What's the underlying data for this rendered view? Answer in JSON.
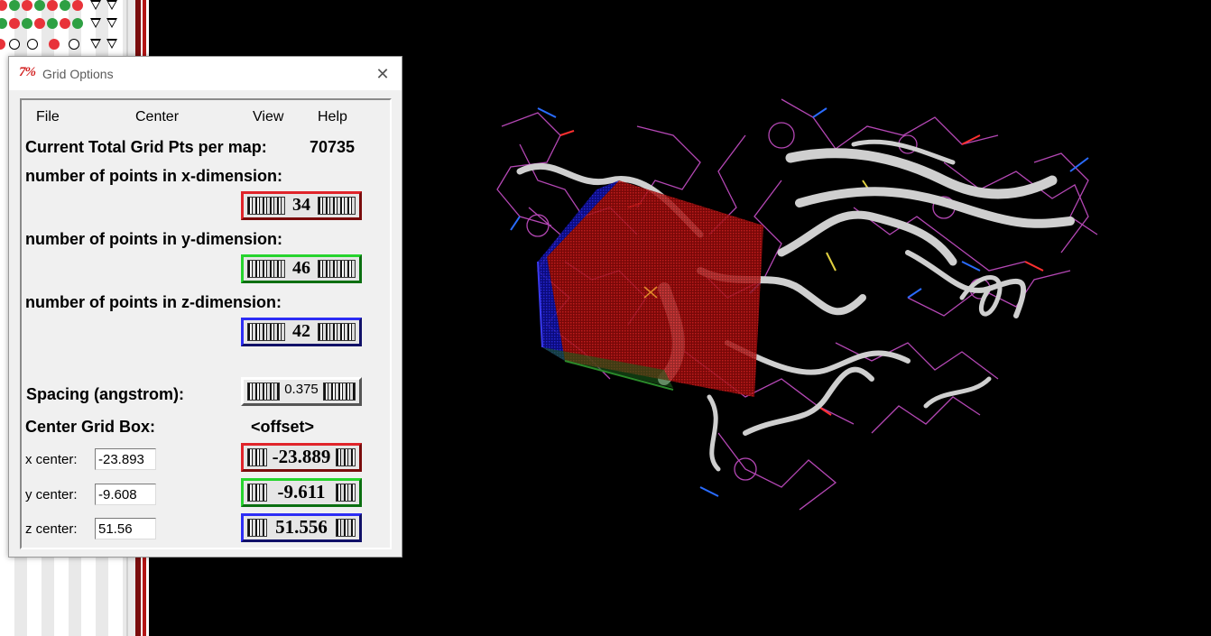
{
  "dialog": {
    "title": "Grid Options",
    "tk_icon": "7%",
    "close_glyph": "✕"
  },
  "menu": {
    "file": "File",
    "center": "Center",
    "view": "View",
    "help": "Help"
  },
  "grid": {
    "total_label": "Current Total Grid Pts per map:",
    "total_value": "70735",
    "x_label": "number of points in x-dimension:",
    "x_value": "34",
    "y_label": "number of points in y-dimension:",
    "y_value": "46",
    "z_label": "number of points in z-dimension:",
    "z_value": "42",
    "spacing_label": "Spacing (angstrom):",
    "spacing_value": "0.375"
  },
  "center": {
    "heading": "Center Grid Box:",
    "offset_label": "<offset>",
    "x_label": "x center:",
    "x_entry": "-23.893",
    "x_offset": "-23.889",
    "y_label": "y center:",
    "y_entry": "-9.608",
    "y_offset": "-9.611",
    "z_label": "z center:",
    "z_entry": "51.56",
    "z_offset": "51.556"
  },
  "colors": {
    "x_axis": "#e0242a",
    "y_axis": "#27d42e",
    "z_axis": "#2d2df5",
    "viewer_bg": "#000000",
    "grid_box_red": "#d11a1a",
    "grid_box_blue": "#1a1ad1"
  },
  "icons": [
    "tk-icon",
    "close-icon",
    "thumbwheel-icon"
  ]
}
